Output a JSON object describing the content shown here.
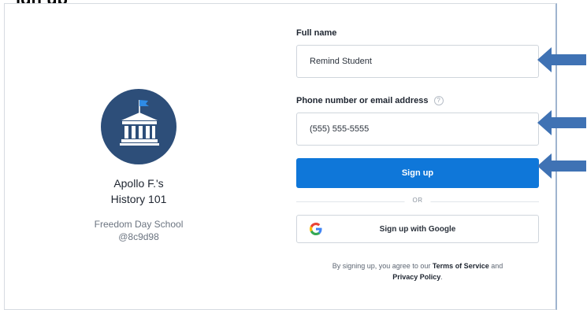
{
  "heading": "ign up",
  "class_card": {
    "teacher": "Apollo F.'s",
    "class_name": "History 101",
    "school": "Freedom Day School",
    "code": "@8c9d98"
  },
  "form": {
    "full_name_label": "Full name",
    "full_name_value": "Remind Student",
    "contact_label": "Phone number or email address",
    "contact_help": "?",
    "contact_value": "(555) 555-5555",
    "signup_label": "Sign up",
    "or_label": "OR",
    "google_label": "Sign up with Google",
    "terms_pre": "By signing up, you agree to our ",
    "terms_link": "Terms of Service",
    "terms_mid": " and",
    "privacy_link": "Privacy Policy",
    "terms_end": "."
  },
  "colors": {
    "primary": "#0f77d9",
    "logo_bg": "#2d4e79",
    "arrow": "#3f72b4"
  },
  "icons": {
    "logo": "school-building-flag-icon",
    "help": "question-circle-icon",
    "google": "google-g-icon",
    "arrow": "left-arrow-icon"
  }
}
